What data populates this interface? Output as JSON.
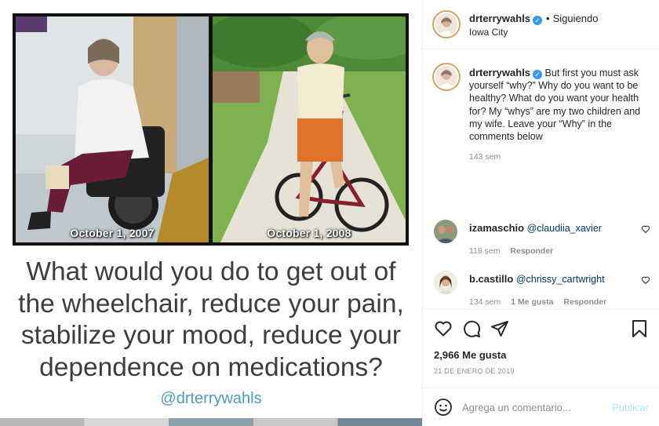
{
  "image": {
    "left_date": "October 1, 2007",
    "right_date": "October 1, 2008",
    "headline_lines": [
      "What would you do to get out of",
      "the wheelchair, reduce your pain,",
      "stabilize your mood, reduce your",
      "dependence on medications?"
    ],
    "handle": "@drterrywahls"
  },
  "header": {
    "username": "drterrywahls",
    "separator": "•",
    "follow_status": "Siguiendo",
    "location": "Iowa City"
  },
  "caption": {
    "username": "drterrywahls",
    "text": "But first you must ask yourself “why?” Why do you want to be healthy? What do you want your health for? My “whys” are my two children and my wife. Leave your “Why” in the comments below",
    "time": "143 sem"
  },
  "comments": [
    {
      "username": "izamaschio",
      "mention": "@claudiia_xavier",
      "time": "118 sem",
      "likes": "",
      "reply": "Responder"
    },
    {
      "username": "b.castillo",
      "mention": "@chrissy_cartwright",
      "time": "134 sem",
      "likes": "1 Me gusta",
      "reply": "Responder"
    }
  ],
  "engagement": {
    "likes": "2,966 Me gusta",
    "date": "21 DE ENERO DE 2019"
  },
  "add_comment": {
    "placeholder": "Agrega un comentario...",
    "publish_label": "Publicar"
  },
  "icons": {
    "like": "heart-icon",
    "comment": "comment-icon",
    "share": "share-icon",
    "save": "bookmark-icon",
    "emoji": "emoji-icon",
    "verified": "verified-badge-icon"
  },
  "colors": {
    "verified": "#3897f0",
    "mention": "#00376b",
    "handle_blue": "#4a9cc6",
    "publish_disabled": "#b2dffc",
    "meta_gray": "#8e8e8e"
  }
}
